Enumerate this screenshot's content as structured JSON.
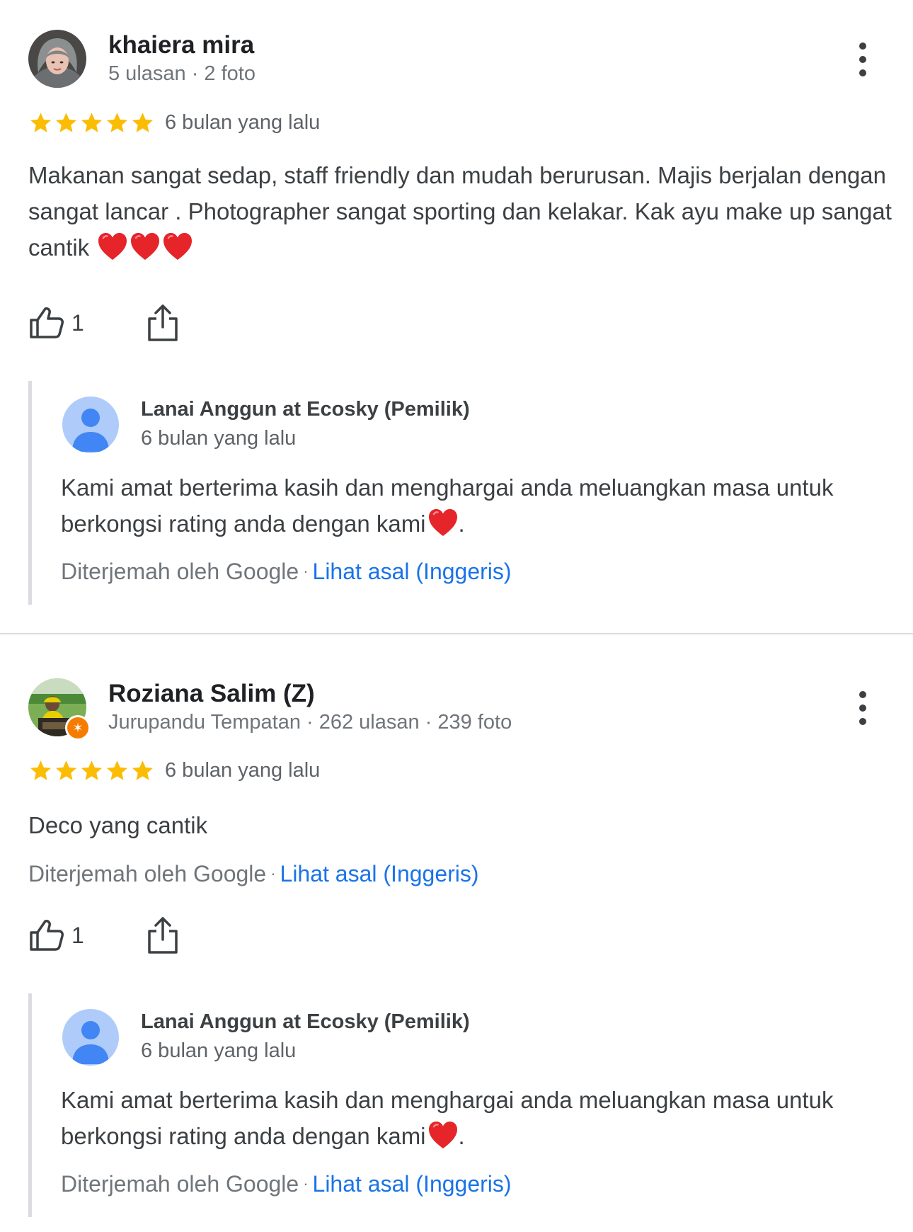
{
  "reviews": [
    {
      "author": "khaiera mira",
      "meta": "5 ulasan · 2 foto",
      "rating": 5,
      "date": "6 bulan yang lalu",
      "text": "Makanan sangat sedap, staff friendly dan mudah berurusan. Majis berjalan dengan sangat lancar . Photographer sangat sporting dan kelakar. Kak ayu make up sangat cantik",
      "likes": "1",
      "reply": {
        "owner": "Lanai Anggun at Ecosky (Pemilik)",
        "date": "6 bulan yang lalu",
        "text": "Kami amat berterima kasih dan menghargai anda meluangkan masa untuk berkongsi rating anda dengan kami",
        "text_end": ".",
        "translated_by": "Diterjemah oleh Google",
        "see_original": "Lihat asal (Inggeris)"
      }
    },
    {
      "author": "Roziana Salim (Z)",
      "meta": "Jurupandu Tempatan · 262 ulasan · 239 foto",
      "rating": 5,
      "date": "6 bulan yang lalu",
      "text": "Deco yang cantik",
      "translated_by": "Diterjemah oleh Google",
      "see_original": "Lihat asal (Inggeris)",
      "likes": "1",
      "reply": {
        "owner": "Lanai Anggun at Ecosky (Pemilik)",
        "date": "6 bulan yang lalu",
        "text": "Kami amat berterima kasih dan menghargai anda meluangkan masa untuk berkongsi rating anda dengan kami",
        "text_end": ".",
        "translated_by": "Diterjemah oleh Google",
        "see_original": "Lihat asal (Inggeris)"
      }
    }
  ],
  "colors": {
    "star": "#fbbc04",
    "link": "#1a73e8",
    "heart": "#e5252a",
    "local_guide_badge": "#f57c00"
  },
  "icons": [
    "more-vert-icon",
    "star-icon",
    "thumb-up-icon",
    "share-icon",
    "heart-emoji",
    "person-icon",
    "local-guide-badge-icon"
  ]
}
